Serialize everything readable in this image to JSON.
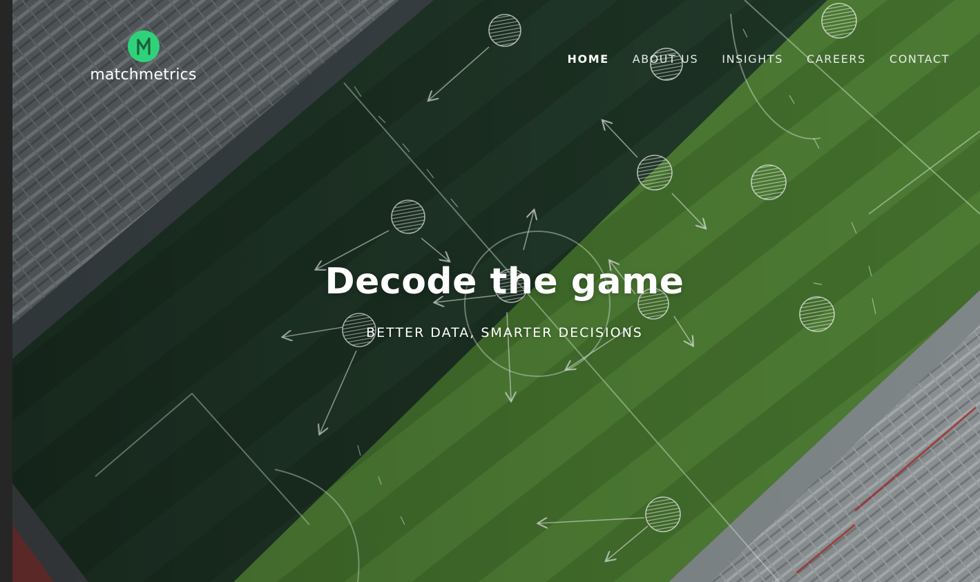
{
  "brand": {
    "name": "matchmetrics",
    "accent_color": "#2fd27a",
    "logo_icon": "matchmetrics-logo-icon"
  },
  "nav": {
    "items": [
      {
        "label": "HOME",
        "active": true
      },
      {
        "label": "ABOUT US",
        "active": false
      },
      {
        "label": "INSIGHTS",
        "active": false
      },
      {
        "label": "CAREERS",
        "active": false
      },
      {
        "label": "CONTACT",
        "active": false
      }
    ]
  },
  "hero": {
    "title": "Decode the game",
    "subtitle": "BETTER DATA, SMARTER DECISIONS",
    "background_image": "aerial-football-pitch-with-tactics-sketch"
  }
}
